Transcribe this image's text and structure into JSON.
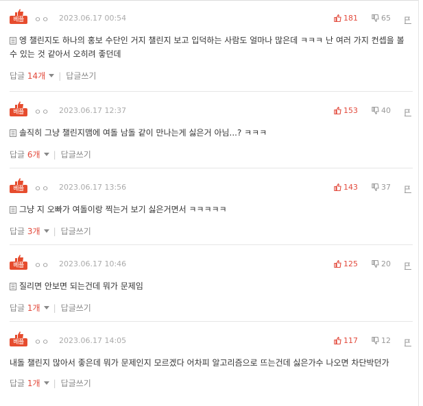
{
  "comments": [
    {
      "badge": "베플",
      "nick": "ㅇㅇ",
      "date": "2023.06.17 00:54",
      "up": "181",
      "down": "65",
      "text": "엥 챌린지도 하나의 홍보 수단인 거지 챌린지 보고 입덕하는 사람도 얼마나 많은데 ㅋㅋㅋ 난 여러 가지 컨셉을 볼 수 있는 것 같아서 오히려 좋던데",
      "reply_label": "답글",
      "reply_count": "14개",
      "write_label": "답글쓰기"
    },
    {
      "badge": "베플",
      "nick": "ㅇㅇ",
      "date": "2023.06.17 12:37",
      "up": "153",
      "down": "40",
      "text": "솔직히 그냥 챌린지맴에 여돌 남돌 같이 만나는게 싫은거 아님...? ㅋㅋㅋ",
      "reply_label": "답글",
      "reply_count": "6개",
      "write_label": "답글쓰기"
    },
    {
      "badge": "베플",
      "nick": "ㅇㅇ",
      "date": "2023.06.17 13:56",
      "up": "143",
      "down": "37",
      "text": "그냥 지 오빠가 여돌이랑 찍는거 보기 싫은거면서 ㅋㅋㅋㅋㅋ",
      "reply_label": "답글",
      "reply_count": "3개",
      "write_label": "답글쓰기"
    },
    {
      "badge": "베플",
      "nick": "ㅇㅇ",
      "date": "2023.06.17 10:46",
      "up": "125",
      "down": "20",
      "text": "질리면 안보면 되는건데 뭐가 문제임",
      "reply_label": "답글",
      "reply_count": "1개",
      "write_label": "답글쓰기"
    },
    {
      "badge": "베플",
      "nick": "ㅇㅇ",
      "date": "2023.06.17 14:05",
      "up": "117",
      "down": "12",
      "text": "내돌 챌린지 많아서 좋은데 뭐가 문제인지 모르겠다 어차피 알고리즘으로 뜨는건데 싫은가수 나오면 차단박던가",
      "reply_label": "답글",
      "reply_count": "1개",
      "write_label": "답글쓰기"
    }
  ],
  "colors": {
    "accent": "#e2493b",
    "badge": "#e64c2e",
    "muted": "#999999"
  }
}
